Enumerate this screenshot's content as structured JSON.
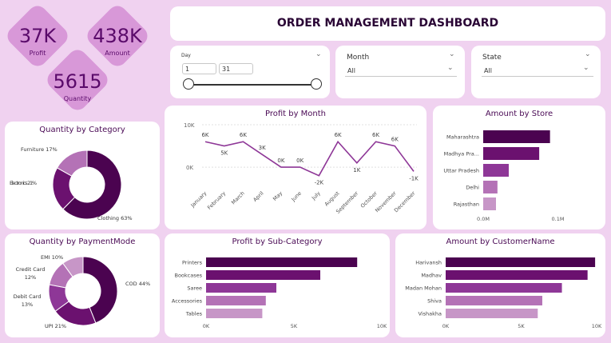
{
  "title": "ORDER MANAGEMENT DASHBOARD",
  "kpis": {
    "profit": {
      "value": "37K",
      "label": "Profit"
    },
    "amount": {
      "value": "438K",
      "label": "Amount"
    },
    "quantity": {
      "value": "5615",
      "label": "Quantity"
    }
  },
  "filters": {
    "day": {
      "label": "Day",
      "from": "1",
      "to": "31"
    },
    "month": {
      "label": "Month",
      "value": "All"
    },
    "state": {
      "label": "State",
      "value": "All"
    }
  },
  "colors": {
    "dark": "#4b0350",
    "mid": "#6b116f",
    "med": "#8e3797",
    "light": "#b472b6",
    "pale": "#c796c7"
  },
  "chart_data": [
    {
      "id": "quantity_by_category",
      "type": "pie",
      "title": "Quantity by Category",
      "slices": [
        {
          "label": "Clothing",
          "value": 63,
          "text": "Clothing 63%"
        },
        {
          "label": "Electronics",
          "value": 21,
          "text": "Electronics 21%"
        },
        {
          "label": "Furniture",
          "value": 17,
          "text": "Furniture 17%"
        }
      ]
    },
    {
      "id": "quantity_by_paymentmode",
      "type": "pie",
      "title": "Quantity by PaymentMode",
      "slices": [
        {
          "label": "COD",
          "value": 44,
          "text": "COD 44%"
        },
        {
          "label": "UPI",
          "value": 21,
          "text": "UPI 21%"
        },
        {
          "label": "Debit Card",
          "value": 13,
          "text": "Debit Card 13%"
        },
        {
          "label": "Credit Card",
          "value": 12,
          "text": "Credit Card 12%"
        },
        {
          "label": "EMI",
          "value": 10,
          "text": "EMI 10%"
        }
      ]
    },
    {
      "id": "profit_by_month",
      "type": "line",
      "title": "Profit by Month",
      "x": [
        "January",
        "February",
        "March",
        "April",
        "May",
        "June",
        "July",
        "August",
        "September",
        "October",
        "November",
        "December"
      ],
      "y": [
        6000,
        5000,
        6000,
        3000,
        0,
        0,
        -2000,
        6000,
        1000,
        6000,
        5000,
        -1000
      ],
      "point_labels": [
        "6K",
        "5K",
        "6K",
        "3K",
        "0K",
        "0K",
        "-2K",
        "6K",
        "1K",
        "6K",
        "6K",
        "-1K"
      ],
      "yticks": [
        "10K",
        "0K"
      ],
      "ylim": [
        -3000,
        10000
      ]
    },
    {
      "id": "amount_by_store",
      "type": "bar",
      "title": "Amount by Store",
      "categories": [
        "Maharashtra",
        "Madhya Pra...",
        "Uttar Pradesh",
        "Delhi",
        "Rajasthan"
      ],
      "values": [
        0.136,
        0.114,
        0.052,
        0.029,
        0.026
      ],
      "xticks": [
        "0.0M",
        "0.1M"
      ],
      "xlim": [
        0,
        0.2
      ]
    },
    {
      "id": "profit_by_subcategory",
      "type": "bar",
      "title": "Profit by Sub-Category",
      "categories": [
        "Printers",
        "Bookcases",
        "Saree",
        "Accessories",
        "Tables"
      ],
      "values": [
        8600,
        6500,
        4000,
        3400,
        3200
      ],
      "xticks": [
        "0K",
        "5K",
        "10K"
      ],
      "xlim": [
        0,
        10000
      ]
    },
    {
      "id": "amount_by_customername",
      "type": "bar",
      "title": "Amount by CustomerName",
      "categories": [
        "Harivansh",
        "Madhav",
        "Madan Mohan",
        "Shiva",
        "Vishakha"
      ],
      "values": [
        9900,
        9400,
        7700,
        6400,
        6100
      ],
      "xticks": [
        "0K",
        "5K",
        "10K"
      ],
      "xlim": [
        0,
        10000
      ]
    }
  ]
}
